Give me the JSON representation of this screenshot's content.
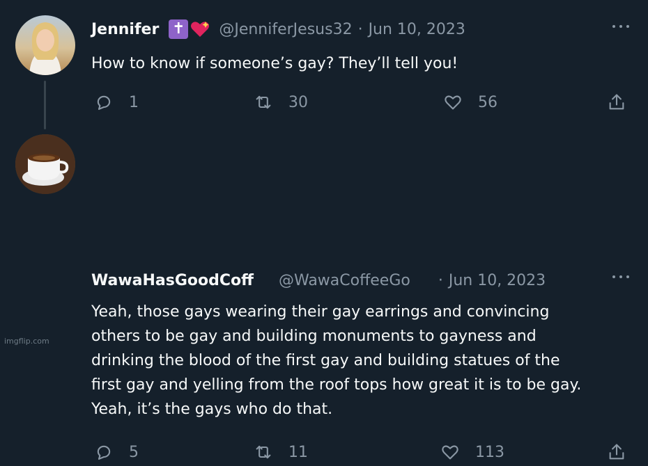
{
  "tweets": [
    {
      "name": "Jennifer",
      "handle": "@JenniferJesus32",
      "separator": "·",
      "date": "Jun 10, 2023",
      "text_lines": [
        "How to know if someone’s gay? They’ll tell you!"
      ],
      "actions": {
        "replies": "1",
        "retweets": "30",
        "likes": "56"
      },
      "avatar": "profile-photo-woman",
      "name_badges": [
        "latin-cross-emoji",
        "sparkling-heart-emoji"
      ]
    },
    {
      "name": "WawaHasGoodCoff",
      "handle": "@WawaCoffeeGo",
      "separator": "·",
      "date": "Jun 10, 2023",
      "text_lines": [
        "Yeah, those gays wearing their gay earrings and convincing",
        "others to be gay and building monuments to gayness and",
        "drinking the blood of the first gay and building statues of the",
        "first gay and yelling from the roof tops how great it is to be gay.",
        "Yeah, it’s the gays who do that."
      ],
      "actions": {
        "replies": "5",
        "retweets": "11",
        "likes": "113"
      },
      "avatar": "coffee-cup-photo"
    }
  ],
  "watermark": "imgflip.com",
  "colors": {
    "background": "#15202b",
    "text": "#f7f9f9",
    "muted": "#8b98a5",
    "thread_line": "#38444d"
  }
}
